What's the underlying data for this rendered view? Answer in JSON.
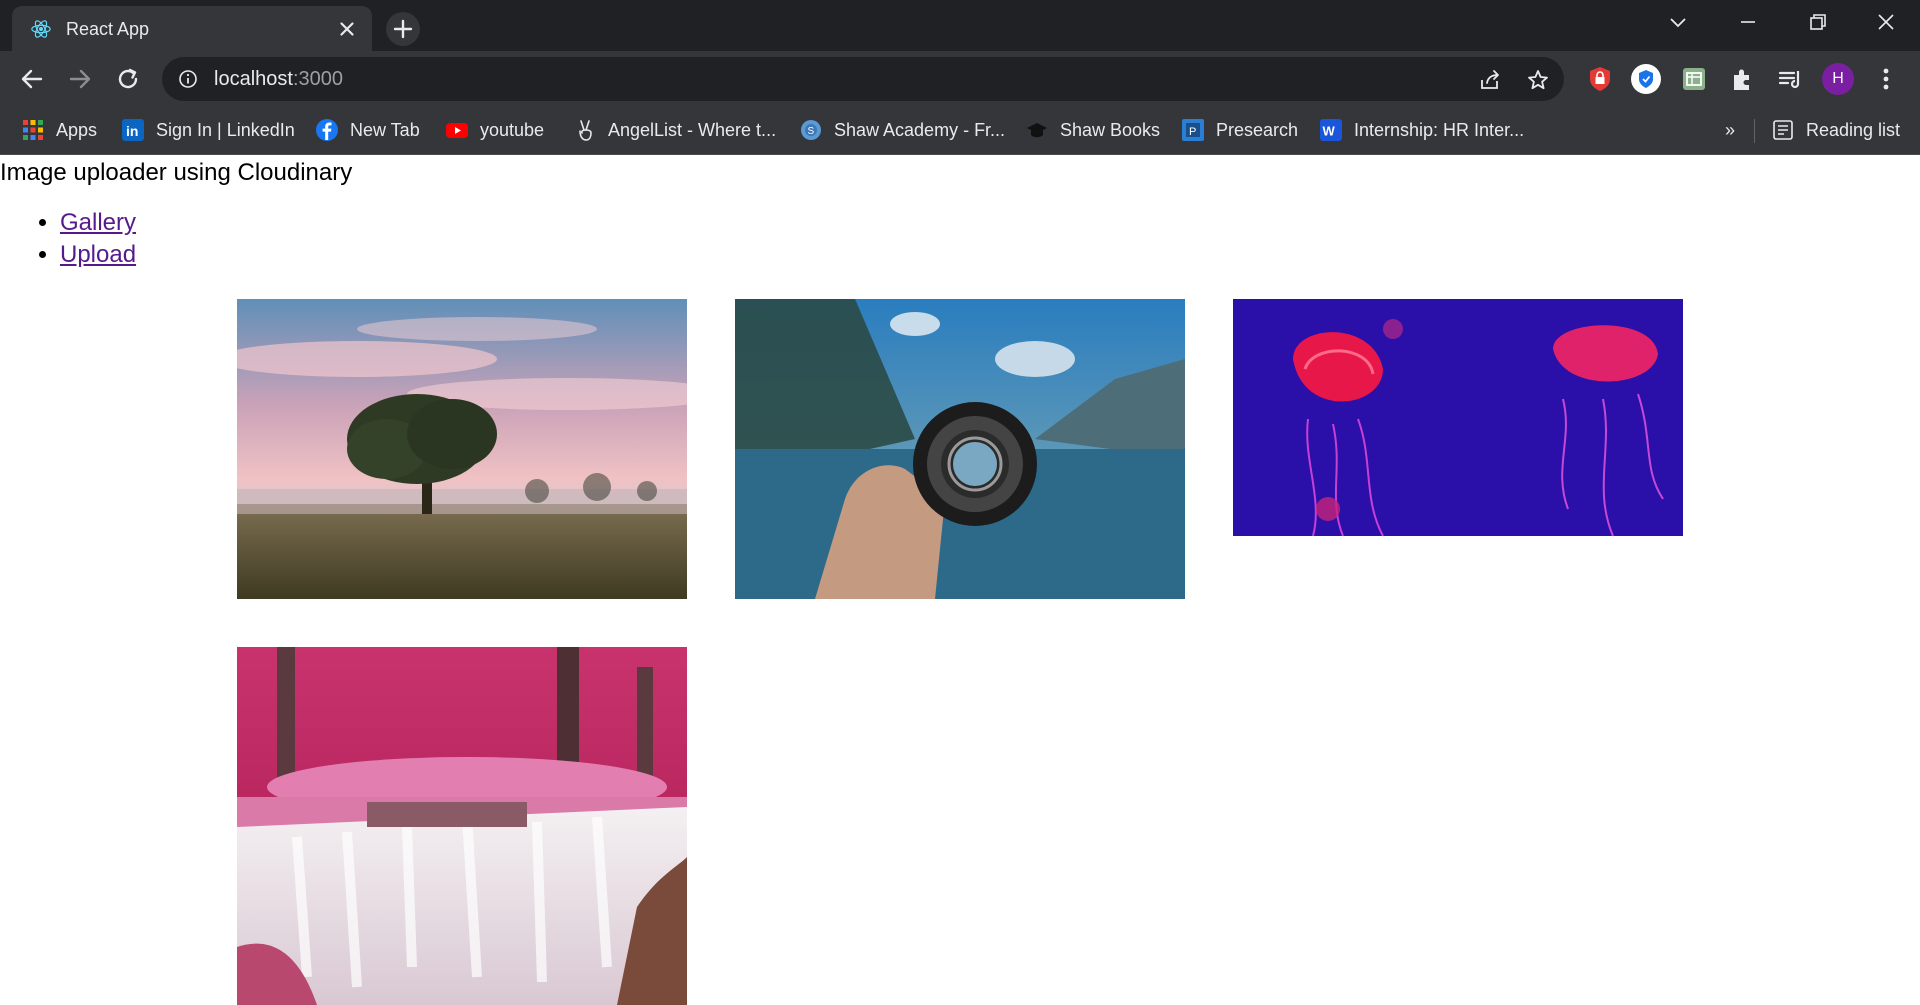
{
  "browser": {
    "tab_title": "React App",
    "url_host": "localhost",
    "url_rest": ":3000",
    "accent": "#202124",
    "profile_initial": "H",
    "profile_color": "#7b1fa2"
  },
  "bookmarks": {
    "items": [
      {
        "label": "Apps",
        "icon": "apps-grid-icon"
      },
      {
        "label": "Sign In | LinkedIn",
        "icon": "linkedin-icon"
      },
      {
        "label": "New Tab",
        "icon": "facebook-icon"
      },
      {
        "label": "youtube",
        "icon": "youtube-icon"
      },
      {
        "label": "AngelList - Where t...",
        "icon": "angellist-icon"
      },
      {
        "label": "Shaw Academy - Fr...",
        "icon": "shaw-academy-icon"
      },
      {
        "label": "Shaw Books",
        "icon": "graduation-cap-icon"
      },
      {
        "label": "Presearch",
        "icon": "presearch-icon"
      },
      {
        "label": "Internship: HR Inter...",
        "icon": "internship-icon"
      }
    ],
    "overflow": "»",
    "reading_list": "Reading list"
  },
  "page": {
    "heading": "Image uploader using Cloudinary",
    "nav": [
      {
        "label": "Gallery"
      },
      {
        "label": "Upload"
      }
    ],
    "gallery": [
      {
        "subject": "tree-at-sunset"
      },
      {
        "subject": "hand-holding-lens"
      },
      {
        "subject": "jellyfish"
      },
      {
        "subject": "pink-waterfall"
      }
    ]
  }
}
